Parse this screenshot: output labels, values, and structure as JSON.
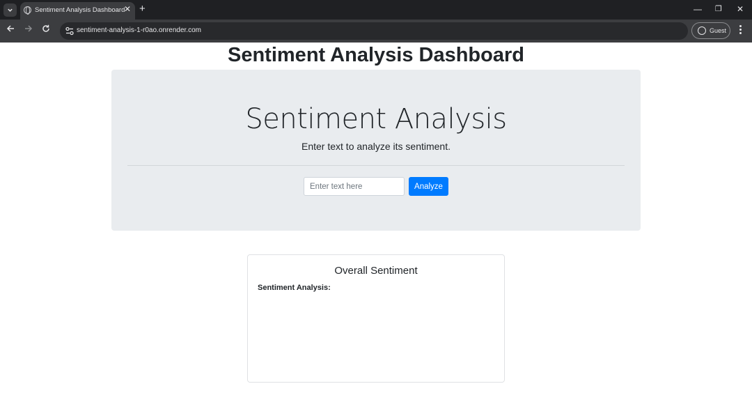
{
  "browser": {
    "tab_title": "Sentiment Analysis Dashboard",
    "url": "sentiment-analysis-1-r0ao.onrender.com",
    "profile_label": "Guest",
    "icons": {
      "tab_search": "chevron-down-icon",
      "favicon": "globe-icon",
      "tab_close": "close-icon",
      "new_tab": "plus-icon",
      "back": "arrow-left-icon",
      "forward": "arrow-right-icon",
      "reload": "reload-icon",
      "site_info": "tune-icon",
      "profile": "person-icon",
      "menu": "more-vert-icon"
    }
  },
  "page": {
    "heading": "Sentiment Analysis Dashboard",
    "jumbotron": {
      "title": "Sentiment Analysis",
      "lead": "Enter text to analyze its sentiment.",
      "input_placeholder": "Enter text here",
      "input_value": "",
      "button_label": "Analyze"
    },
    "card": {
      "title": "Overall Sentiment",
      "label": "Sentiment Analysis:"
    }
  },
  "colors": {
    "primary": "#007bff",
    "jumbotron_bg": "#e9ecef",
    "chrome_dark": "#1f2023",
    "chrome_toolbar": "#3c3d40"
  }
}
